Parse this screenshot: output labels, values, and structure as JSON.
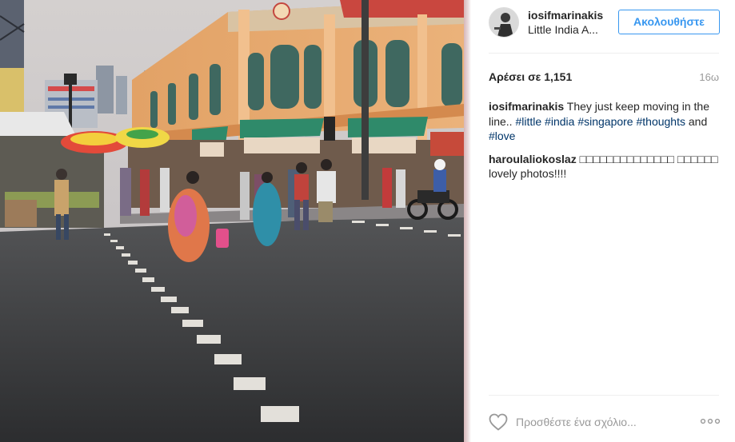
{
  "post": {
    "username": "iosifmarinakis",
    "location": "Little India A...",
    "follow_label": "Ακολουθήστε",
    "likes_text": "Αρέσει σε 1,151",
    "time": "16ω"
  },
  "caption": {
    "user": "iosifmarinakis",
    "text": " They just keep moving in the line.. ",
    "hashtags": [
      "#little",
      "#india",
      "#singapore",
      "#thoughts",
      "#love"
    ],
    "joiner": "and"
  },
  "comments": [
    {
      "user": "haroulaliokoslaz",
      "text": " □□□□□□□□□□□□□□ □□□□□□ lovely photos!!!!"
    }
  ],
  "add_comment": {
    "placeholder": "Προσθέστε ένα σχόλιο..."
  },
  "icons": {
    "like": "heart-icon",
    "more": "more-options-icon",
    "avatar": "avatar"
  },
  "colors": {
    "accent": "#3897f0",
    "hashtag": "#003569",
    "muted": "#999999",
    "text": "#262626"
  }
}
